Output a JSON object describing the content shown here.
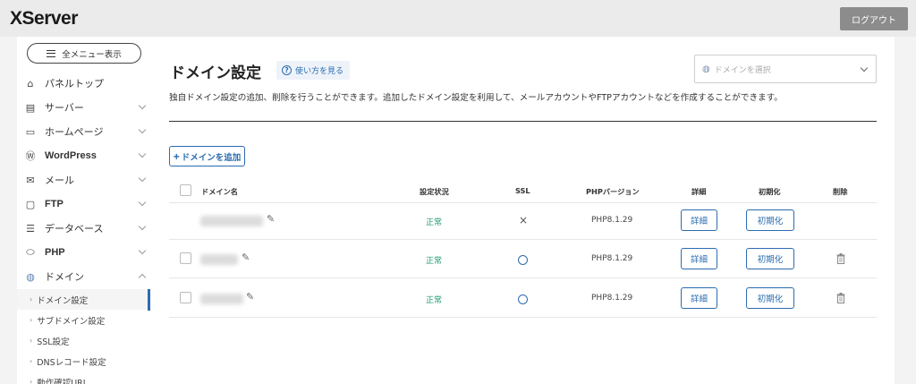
{
  "header": {
    "logo": "XServer",
    "logout_label": "ログアウト"
  },
  "sidebar": {
    "menu_button_label": "全メニュー表示",
    "items": [
      {
        "label": "パネルトップ",
        "icon": "home-icon"
      },
      {
        "label": "サーバー",
        "icon": "server-icon"
      },
      {
        "label": "ホームページ",
        "icon": "window-icon"
      },
      {
        "label": "WordPress",
        "icon": "wordpress-icon"
      },
      {
        "label": "メール",
        "icon": "mail-icon"
      },
      {
        "label": "FTP",
        "icon": "monitor-icon"
      },
      {
        "label": "データベース",
        "icon": "database-icon"
      },
      {
        "label": "PHP",
        "icon": "php-icon"
      },
      {
        "label": "ドメイン",
        "icon": "globe-icon"
      }
    ],
    "sub_items": [
      {
        "label": "ドメイン設定"
      },
      {
        "label": "サブドメイン設定"
      },
      {
        "label": "SSL設定"
      },
      {
        "label": "DNSレコード設定"
      },
      {
        "label": "動作確認URL"
      }
    ]
  },
  "main": {
    "title": "ドメイン設定",
    "howto_label": "使い方を見る",
    "domain_select_placeholder": "ドメインを選択",
    "description": "独自ドメイン設定の追加、削除を行うことができます。追加したドメイン設定を利用して、メールアカウントやFTPアカウントなどを作成することができます。",
    "add_button_label": "ドメインを追加",
    "table": {
      "headers": [
        "ドメイン名",
        "設定状況",
        "SSL",
        "PHPバージョン",
        "詳細",
        "初期化",
        "削除"
      ],
      "rows": [
        {
          "status": "正常",
          "ssl": "×",
          "php": "PHP8.1.29",
          "detail": "詳細",
          "reset": "初期化"
        },
        {
          "status": "正常",
          "ssl": "○",
          "php": "PHP8.1.29",
          "detail": "詳細",
          "reset": "初期化"
        },
        {
          "status": "正常",
          "ssl": "○",
          "php": "PHP8.1.29",
          "detail": "詳細",
          "reset": "初期化"
        }
      ]
    }
  },
  "colors": {
    "accent": "#2b6cb0",
    "status_ok": "#1e9a73",
    "logout_bg": "#8c8c8c"
  }
}
